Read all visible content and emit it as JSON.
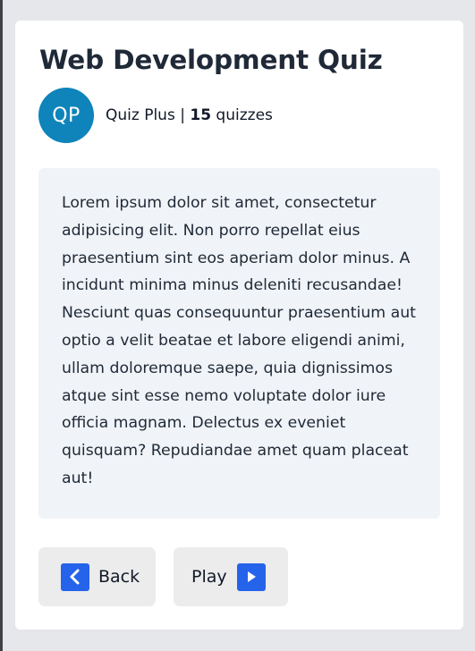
{
  "quiz": {
    "title": "Web Development Quiz",
    "author": {
      "initials": "QP",
      "name": "Quiz Plus",
      "separator": " | ",
      "quiz_count": "15",
      "quiz_count_label": " quizzes"
    },
    "description": "Lorem ipsum dolor sit amet, consectetur adipisicing elit. Non porro repellat eius praesentium sint eos aperiam dolor minus. A incidunt minima minus deleniti recusandae! Nesciunt quas consequuntur praesentium aut optio a velit beatae et labore eligendi animi, ullam doloremque saepe, quia dignissimos atque sint esse nemo voluptate dolor iure officia magnam. Delectus ex eveniet quisquam? Repudiandae amet quam placeat aut!"
  },
  "actions": {
    "back_label": "Back",
    "back_icon": "chevron-left-icon",
    "play_label": "Play",
    "play_icon": "play-icon"
  },
  "colors": {
    "avatar": "#0e84ba",
    "icon_accent": "#2563eb",
    "button_bg": "#ececec",
    "description_bg": "#f0f3f7",
    "page_bg": "#e5e7eb"
  }
}
